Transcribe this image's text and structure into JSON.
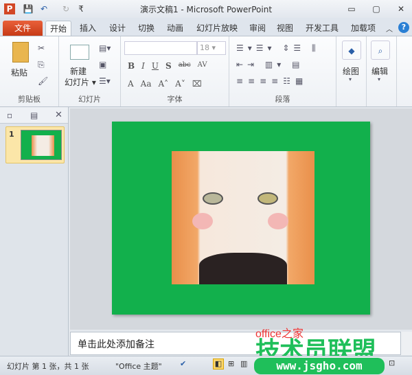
{
  "window": {
    "title": "演示文稿1 - Microsoft PowerPoint",
    "minimize": "▭",
    "maximize": "▢",
    "close": "✕"
  },
  "quick_access": {
    "app_icon": "P",
    "save": "💾",
    "undo": "↶",
    "redo": "↻",
    "customize": "₹"
  },
  "tabs": [
    {
      "label": "文件"
    },
    {
      "label": "开始"
    },
    {
      "label": "插入"
    },
    {
      "label": "设计"
    },
    {
      "label": "切换"
    },
    {
      "label": "动画"
    },
    {
      "label": "幻灯片放映"
    },
    {
      "label": "审阅"
    },
    {
      "label": "视图"
    },
    {
      "label": "开发工具"
    },
    {
      "label": "加载项"
    }
  ],
  "ribbon": {
    "clipboard": {
      "label": "剪贴板",
      "paste": "粘贴"
    },
    "slides": {
      "label": "幻灯片",
      "new_slide_1": "新建",
      "new_slide_2": "幻灯片 ▾"
    },
    "font": {
      "label": "字体",
      "font_name": "",
      "font_size": "18",
      "bold": "B",
      "italic": "I",
      "underline": "U",
      "shadow": "S",
      "strike": "abc",
      "spacing": "AV",
      "color": "A",
      "case": "Aa",
      "grow": "A˄",
      "shrink": "A˅"
    },
    "paragraph": {
      "label": "段落"
    },
    "drawing": {
      "label": "绘图"
    },
    "editing": {
      "label": "编辑"
    }
  },
  "slide_panel": {
    "thumb_number": "1"
  },
  "notes": {
    "placeholder": "单击此处添加备注"
  },
  "status": {
    "slide_info": "幻灯片 第 1 张，共 1 张",
    "theme": "\"Office 主题\""
  },
  "watermark": {
    "main": "技术员联盟",
    "url": "www.jsgho.com",
    "brand": "office之家"
  },
  "colors": {
    "slide_bg": "#12b04c",
    "file_tab": "#d9482a"
  }
}
